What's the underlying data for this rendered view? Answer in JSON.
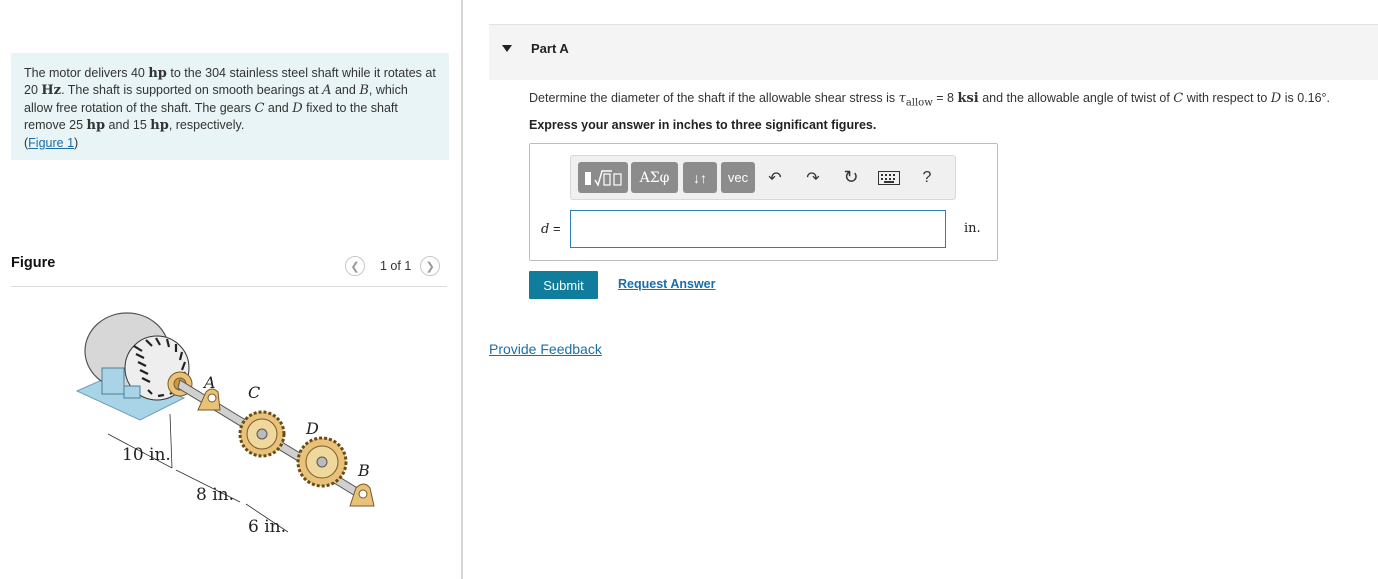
{
  "problem": {
    "t1": "The motor delivers 40 ",
    "hp": "hp",
    "t2": " to the 304 stainless steel shaft while it rotates at 20 ",
    "hz": "Hz",
    "t3": ". The shaft is supported on smooth bearings at ",
    "A": "A",
    "t4": " and ",
    "B": "B",
    "t5": ", which allow free rotation of the shaft. The gears ",
    "C": "C",
    "t6": " and ",
    "D": "D",
    "t7": " fixed to the shaft remove 25 ",
    "t8": " and 15 ",
    "t9": ", respectively.",
    "fig_link_open": "(",
    "fig_link": "Figure 1",
    "fig_link_close": ")"
  },
  "figure_panel": {
    "title": "Figure",
    "prev_icon": "chevron-left-icon",
    "next_icon": "chevron-right-icon",
    "count": "1 of 1",
    "labels": {
      "A": "A",
      "B": "B",
      "C": "C",
      "D": "D",
      "dim1": "10 in.",
      "dim2": "8 in.",
      "dim3": "6 in."
    }
  },
  "part": {
    "title": "Part A",
    "q1": "Determine the diameter of the shaft if the allowable shear stress is ",
    "tau": "τ",
    "tau_sub": "allow",
    "eq": " = 8 ",
    "ksi": "ksi",
    "q2": " and the allowable angle of twist of ",
    "C": "C",
    "q3": " with respect to ",
    "D": "D",
    "q4": " is 0.16°.",
    "instruction": "Express your answer in inches to three significant figures."
  },
  "toolbar": {
    "templates_icon": "templates-sqrt-icon",
    "greek": "ΑΣφ",
    "arrows": "↓↑",
    "vec": "vec",
    "undo": "↶",
    "redo": "↷",
    "reset": "↻",
    "keyboard_icon": "keyboard-icon",
    "help": "?"
  },
  "answer": {
    "var": "d",
    "eq": " =",
    "value": "",
    "unit": "in."
  },
  "buttons": {
    "submit": "Submit",
    "request": "Request Answer"
  },
  "feedback": "Provide Feedback",
  "colors": {
    "accent": "#0f7d9b",
    "link": "#1a6fa8",
    "problem_bg": "#e8f4f5"
  }
}
